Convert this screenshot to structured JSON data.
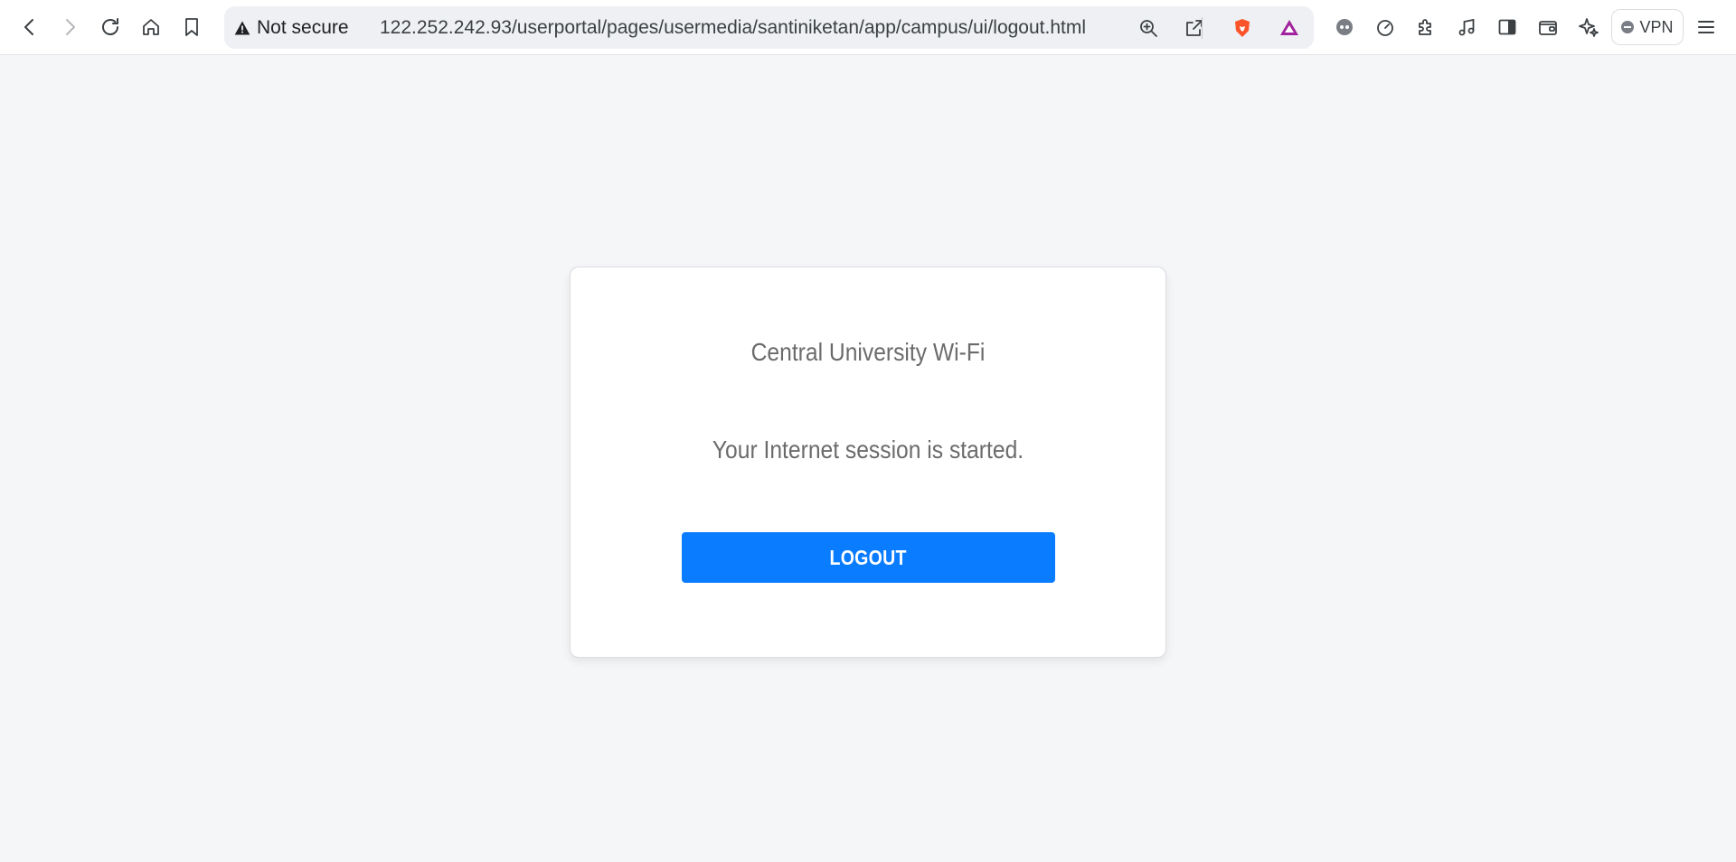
{
  "browser": {
    "security_label": "Not secure",
    "url": "122.252.242.93/userportal/pages/usermedia/santiniketan/app/campus/ui/logout.html",
    "vpn_label": "VPN",
    "icons": [
      "back-icon",
      "forward-icon",
      "reload-icon",
      "home-icon",
      "bookmark-icon",
      "warning-icon",
      "zoom-icon",
      "share-icon",
      "brave-shields-icon",
      "brave-rewards-icon",
      "leo-icon",
      "performance-icon",
      "extensions-icon",
      "media-icon",
      "sidebar-icon",
      "wallet-icon",
      "ai-chat-icon",
      "menu-icon"
    ],
    "colors": {
      "brave_orange": "#fb542b",
      "rewards_purple": "#a0229c"
    }
  },
  "portal": {
    "title": "Central University Wi-Fi",
    "message": "Your Internet session is started.",
    "logout_label": "LOGOUT",
    "colors": {
      "button": "#0a7cff",
      "text": "#6b6b6b",
      "background": "#f5f6f8"
    }
  }
}
